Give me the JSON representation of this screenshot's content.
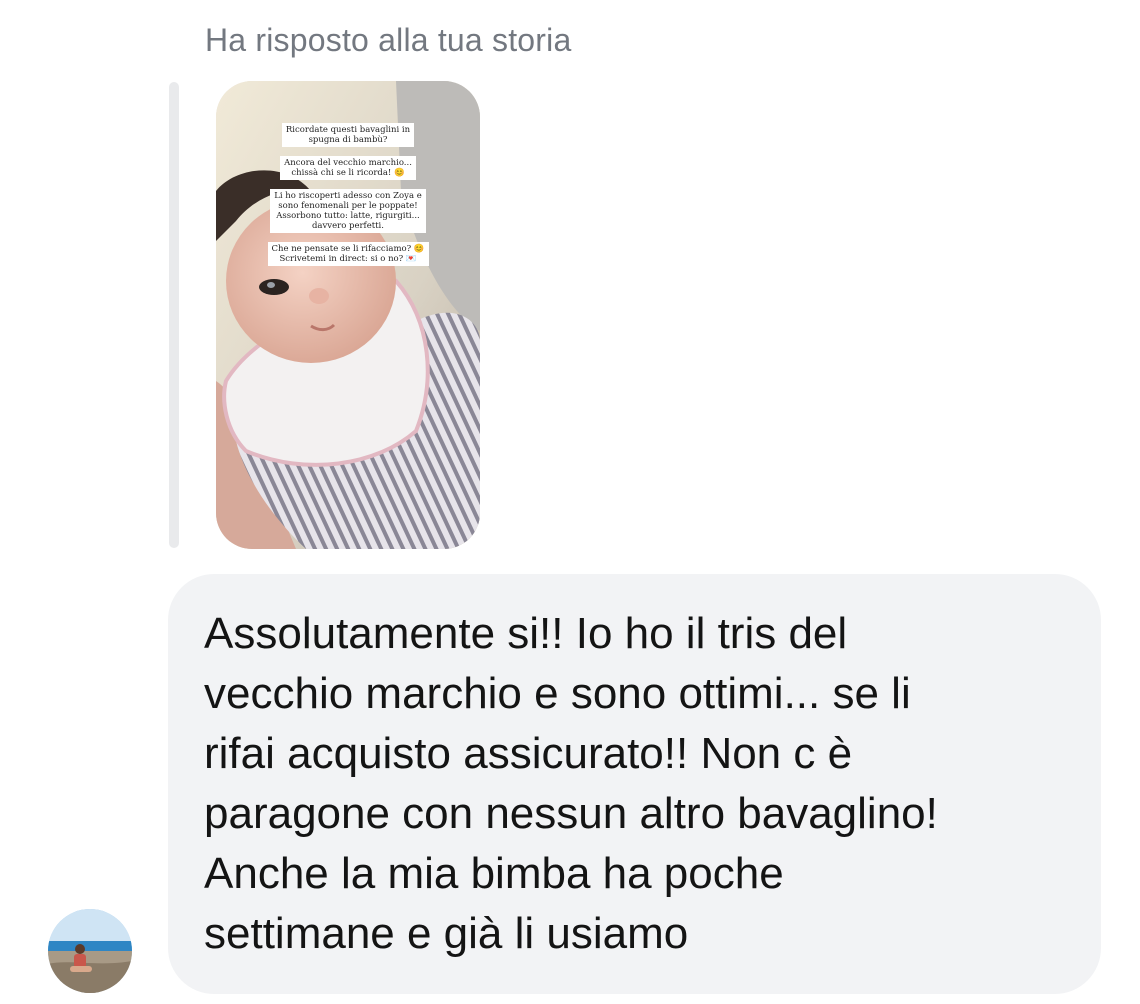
{
  "thread": {
    "reply_context": "Ha risposto alla tua storia"
  },
  "story": {
    "text_lines": [
      "Ricordate questi bavaglini in\nspugna di bambù?",
      "Ancora del vecchio marchio...\nchissà chi se li ricorda! 😊",
      "Li ho riscoperti adesso con Zoya e\nsono fenomenali per le poppate!\nAssorbono tutto: latte, rigurgiti...\ndavvero perfetti.",
      "Che ne pensate se li rifacciamo? 😊\nScrivetemi in direct: si o no? 💌"
    ]
  },
  "message": {
    "text": "Assolutamente si!! Io ho il tris del\nvecchio marchio e sono ottimi... se li\nrifai acquisto assicurato!! Non c è\nparagone con nessun altro bavaglino!\nAnche la mia bimba ha poche\nsettimane e già li usiamo"
  },
  "colors": {
    "bubble_background": "#f2f3f5",
    "header_text": "#737880",
    "quote_bar": "#e9eaec"
  },
  "icons": {
    "avatar": "profile-photo-beach"
  }
}
